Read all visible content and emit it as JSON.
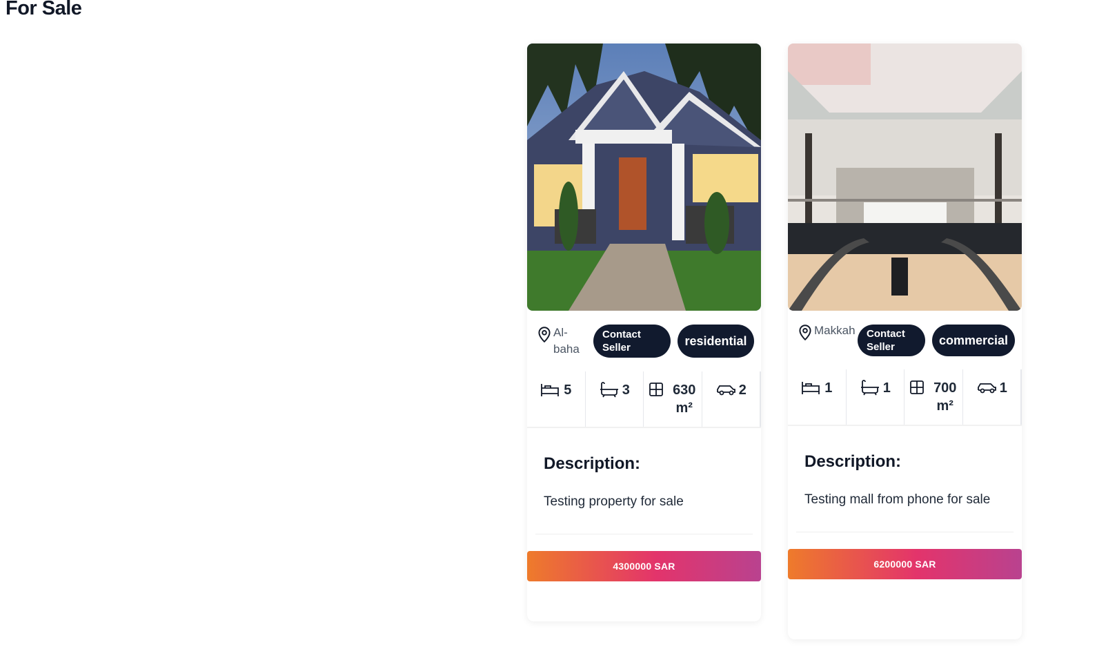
{
  "page": {
    "title": "For Sale"
  },
  "theme": {
    "pill_bg": "#111a2e",
    "price_gradient": [
      "#ee7b2b",
      "#e3346b",
      "#b9428f"
    ]
  },
  "listings": [
    {
      "image_alt": "house exterior",
      "location": "Al-baha",
      "contact_label": "Contact Seller",
      "category": "residential",
      "features": {
        "beds": "5",
        "baths": "3",
        "area": "630 m²",
        "parking": "2"
      },
      "description_title": "Description:",
      "description": "Testing property for sale",
      "price": "4300000 SAR"
    },
    {
      "image_alt": "mall interior",
      "location": "Makkah",
      "contact_label": "Contact Seller",
      "category": "commercial",
      "features": {
        "beds": "1",
        "baths": "1",
        "area": "700 m²",
        "parking": "1"
      },
      "description_title": "Description:",
      "description": "Testing mall from phone for sale",
      "price": "6200000 SAR"
    }
  ]
}
